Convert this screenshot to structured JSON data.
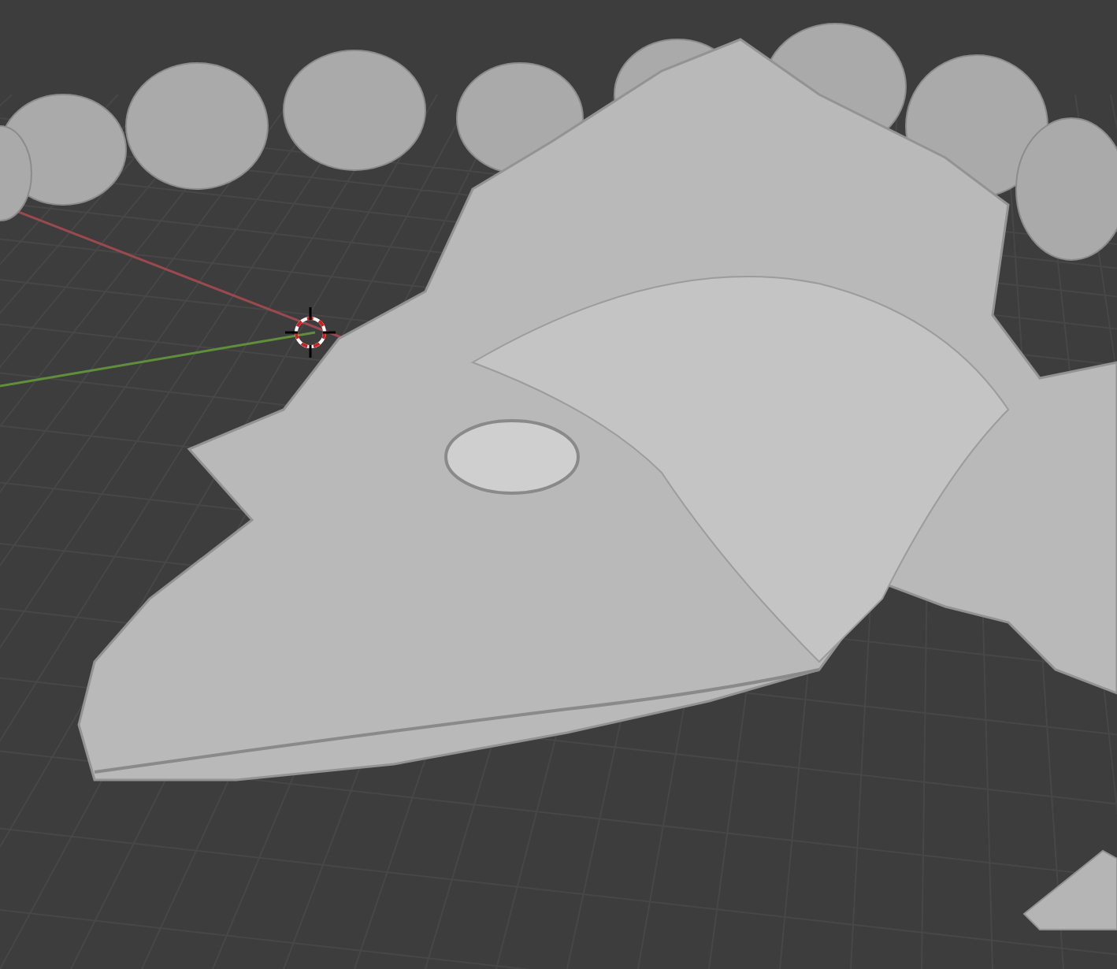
{
  "viewport": {
    "show_grid": true,
    "show_axes": true,
    "show_cursor": true,
    "show_model": true
  }
}
